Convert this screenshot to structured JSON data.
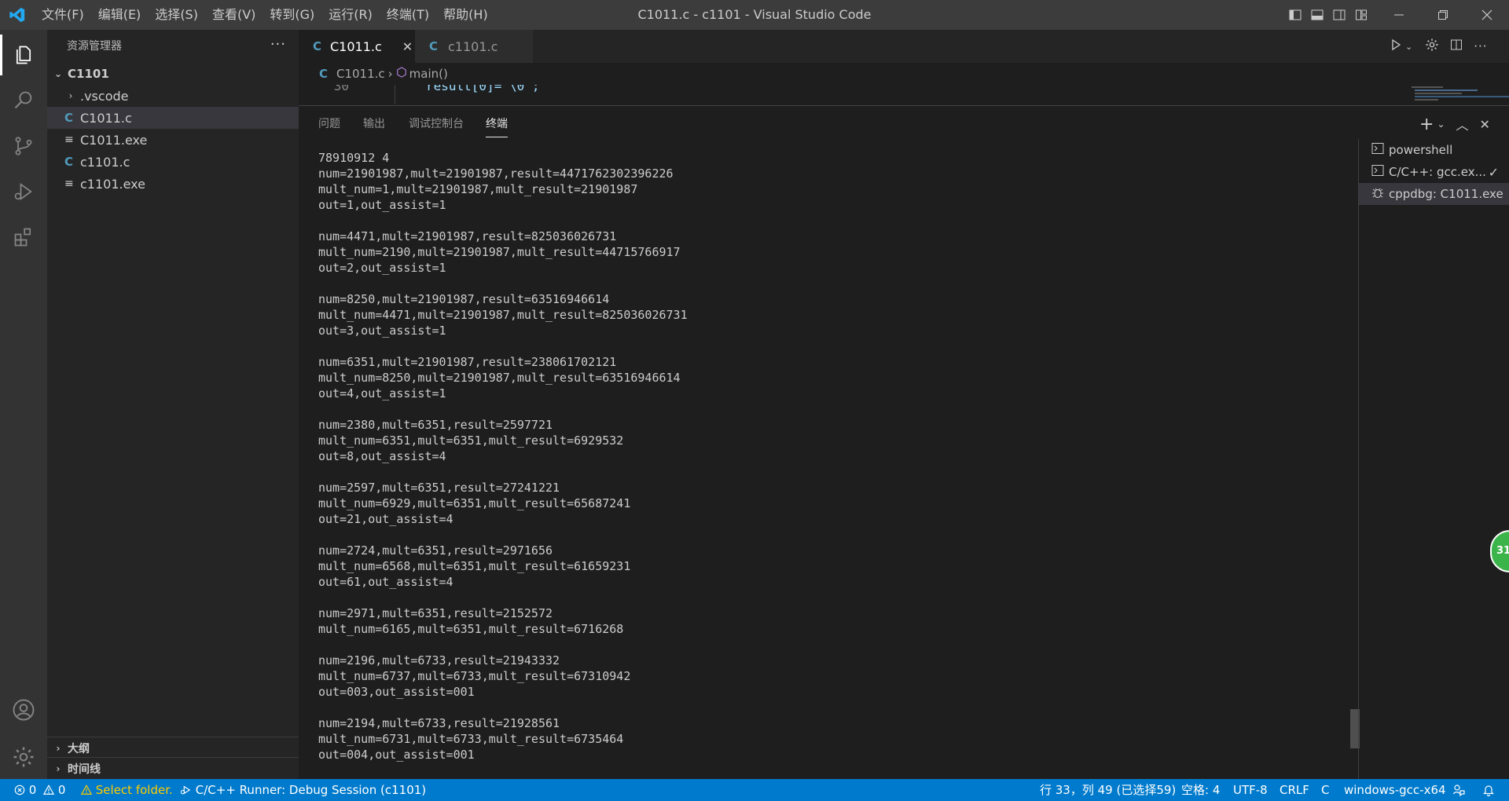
{
  "titlebar": {
    "menus": [
      "文件(F)",
      "编辑(E)",
      "选择(S)",
      "查看(V)",
      "转到(G)",
      "运行(R)",
      "终端(T)",
      "帮助(H)"
    ],
    "window_title": "C1011.c - c1101 - Visual Studio Code"
  },
  "sidebar": {
    "title": "资源管理器",
    "more": "···",
    "folder": "C1101",
    "items": [
      {
        "label": ".vscode",
        "kind": "folder"
      },
      {
        "label": "C1011.c",
        "kind": "c"
      },
      {
        "label": "C1011.exe",
        "kind": "exe"
      },
      {
        "label": "c1101.c",
        "kind": "c"
      },
      {
        "label": "c1101.exe",
        "kind": "exe"
      }
    ],
    "outline": "大纲",
    "timeline": "时间线"
  },
  "editor": {
    "tabs": [
      {
        "label": "C1011.c",
        "active": true
      },
      {
        "label": "c1101.c",
        "active": false
      }
    ],
    "breadcrumb": {
      "file": "C1011.c",
      "symbol": "main()"
    },
    "peek": {
      "line_number": "30",
      "code": "result[0]='\\0';"
    }
  },
  "panel": {
    "tabs": [
      "问题",
      "输出",
      "调试控制台",
      "终端"
    ],
    "active_tab": "终端",
    "terminal_lines": [
      "78910912 4",
      "num=21901987,mult=21901987,result=4471762302396226",
      "mult_num=1,mult=21901987,mult_result=21901987",
      "out=1,out_assist=1",
      "",
      "num=4471,mult=21901987,result=825036026731",
      "mult_num=2190,mult=21901987,mult_result=44715766917",
      "out=2,out_assist=1",
      "",
      "num=8250,mult=21901987,result=63516946614",
      "mult_num=4471,mult=21901987,mult_result=825036026731",
      "out=3,out_assist=1",
      "",
      "num=6351,mult=21901987,result=238061702121",
      "mult_num=8250,mult=21901987,mult_result=63516946614",
      "out=4,out_assist=1",
      "",
      "num=2380,mult=6351,result=2597721",
      "mult_num=6351,mult=6351,mult_result=6929532",
      "out=8,out_assist=4",
      "",
      "num=2597,mult=6351,result=27241221",
      "mult_num=6929,mult=6351,mult_result=65687241",
      "out=21,out_assist=4",
      "",
      "num=2724,mult=6351,result=2971656",
      "mult_num=6568,mult=6351,mult_result=61659231",
      "out=61,out_assist=4",
      "",
      "num=2971,mult=6351,result=2152572",
      "mult_num=6165,mult=6351,mult_result=6716268",
      "",
      "num=2196,mult=6733,result=21943332",
      "mult_num=6737,mult=6733,mult_result=67310942",
      "out=003,out_assist=001",
      "",
      "num=2194,mult=6733,result=21928561",
      "mult_num=6731,mult=6733,mult_result=6735464",
      "out=004,out_assist=001"
    ],
    "terminals": [
      {
        "label": "powershell"
      },
      {
        "label": "C/C++: gcc.ex...",
        "status": "✓"
      },
      {
        "label": "cppdbg: C1011.exe"
      }
    ]
  },
  "statusbar": {
    "errors": "0",
    "warnings": "0",
    "select_folder": "Select folder.",
    "runner": "C/C++ Runner: Debug Session (c1101)",
    "position": "行 33，列 49 (已选择59)",
    "spaces": "空格: 4",
    "encoding": "UTF-8",
    "eol": "CRLF",
    "language": "C",
    "config": "windows-gcc-x64"
  },
  "badge": {
    "text": "31"
  },
  "colors": {
    "accent": "#007acc",
    "c_file": "#519aba",
    "warning": "#ffcc00",
    "badge": "#3bb44a"
  }
}
